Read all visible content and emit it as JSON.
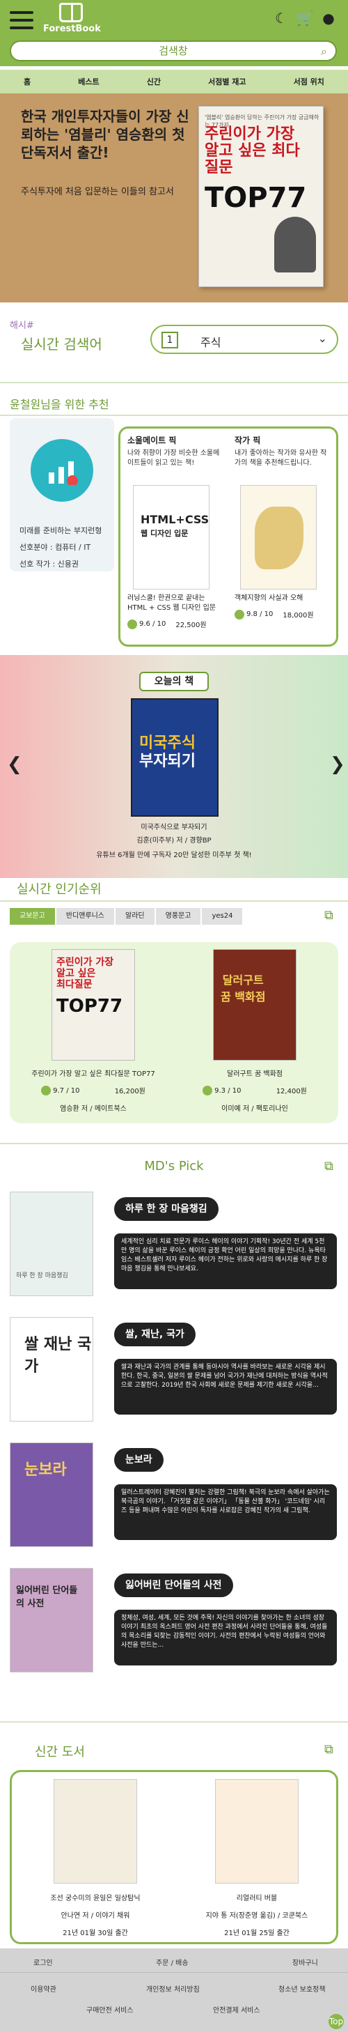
{
  "app": {
    "logo_text": "ForestBook"
  },
  "search": {
    "placeholder": "검색창"
  },
  "nav": [
    "홈",
    "베스트",
    "신간",
    "서점별 재고",
    "서점 위치"
  ],
  "banner": {
    "title": "한국 개인투자자들이 가장 신뢰하는 '염블리' 염승환의 첫 단독저서 출간!",
    "subtitle": "주식투자에 처음 입문하는 이들의 참고서",
    "book_top": "'염블리' 염승환이 답하는 주린이가 가장 궁금해하는 77가지",
    "book_title": "주린이가 가장 알고 싶은 최다질문",
    "book_big": "TOP77"
  },
  "realtime": {
    "hash": "해시#",
    "title": "실시간 검색어",
    "rank": "1",
    "keyword": "주식"
  },
  "recommend": {
    "title": "윤철원님을 위한 추천",
    "profile_label": "미래를 준비하는 부지런형",
    "field": "선호분야 : 컴퓨터 / IT",
    "author": "선호 작가 : 신용권",
    "soulmate": {
      "header": "소울메이트 픽",
      "desc": "나와 취향이 가장 비슷한 소울메이트들이 읽고 있는 책!",
      "book_title": "러닝스쿨! 한권으로 끝내는 HTML + CSS 웹 디자인 입문",
      "rating": "9.6 / 10",
      "price": "22,500원"
    },
    "writer": {
      "header": "작가 픽",
      "desc": "내가 좋아하는 작가와 유사한 작가의 책을 추천해드립니다.",
      "book_title": "객체지향의 사실과 오해",
      "rating": "9.8 / 10",
      "price": "18,000원"
    }
  },
  "today": {
    "title": "오늘의 책",
    "book_title": "미국주식으로 부자되기",
    "author": "김훈(미주부) 저 / 경향BP",
    "desc": "유튜브 6개월 만에 구독자 20만 달성한 미주부 첫 책!"
  },
  "ranking": {
    "title": "실시간 인기순위",
    "tabs": [
      "교보문고",
      "반디앤루니스",
      "알라딘",
      "영풍문고",
      "yes24"
    ],
    "items": [
      {
        "title": "주린이가 가장 알고 싶은 최다질문 TOP77",
        "rating": "9.7 / 10",
        "price": "16,200원",
        "author": "염승환 저 / 메이트북스"
      },
      {
        "title": "달러구트 꿈 백화점",
        "rating": "9.3 / 10",
        "price": "12,400원",
        "author": "이미예 저 / 팩토리나인"
      }
    ]
  },
  "md": {
    "title": "MD's Pick",
    "items": [
      {
        "head": "하루 한 장 마음챙김",
        "desc": "세계적인 심리 치료 전문가 루이스 헤이의 이야기 기획작! 30년간 전 세계 5천만 명의 삶을 바꾼 루이스 헤이의 긍정 확언 어린 일상의 희망을 만나다. 뉴욕타임스 베스트셀러 저자 루이스 헤이가 전하는 위로와 사랑의 메시지를 하루 한 장 마음 챙김을 통해 만나보세요.",
        "img_title": "하루 한 장 마음챙김"
      },
      {
        "head": "쌀, 재난, 국가",
        "desc": "쌀과 재난과 국가의 관계를 통해 동아시아 역사를 바라보는 새로운 시각을 제시한다. 한국, 중국, 일본의 쌀 문제를 넘어 국가가 재난에 대처하는 방식을 역사적으로 고찰한다. 2019년 한국 사회에 새로운 문제를 제기한 새로운 시각을...",
        "img_title": "쌀 재난 국가"
      },
      {
        "head": "눈보라",
        "desc": "일러스트레이터 강혜진이 펼치는 강렬한 그림책! 북극의 눈보라 속에서 살아가는 북극곰의 이야기. 「거짓말 같은 이야기」 「동물 산불 화가」 '코드네임' 시리즈 등을 펴내며 수많은 어린이 독자를 사로잡은 강혜진 작가의 새 그림책.",
        "img_title": "눈보라"
      },
      {
        "head": "잃어버린 단어들의 사전",
        "desc": "정체성, 여성, 세계, 모든 것에 주목! 자신의 이야기를 찾아가는 한 소녀의 성장 이야기 최초의 옥스퍼드 영어 사전 편찬 과정에서 사라진 단어들을 통해, 여성들의 목소리를 되찾는 감동적인 이야기. 사전의 편찬에서 누락된 여성들의 언어와 사전을 만드는...",
        "img_title": "잃어버린 단어들의 사전"
      }
    ]
  },
  "new_books": {
    "title": "신간 도서",
    "items": [
      {
        "title": "조선 궁수미의 윤일은 일상탐닉",
        "author": "안나연 저 / 이야기 채워",
        "date": "21년 01월 30일 출간"
      },
      {
        "title": "리얼러티 버블",
        "author": "지야 통 저(장준영 옮김) / 코쿤북스",
        "date": "21년 01월 25일 출간"
      }
    ]
  },
  "footer": {
    "row1": [
      "로그인",
      "주문 / 배송",
      "장바구니"
    ],
    "row2": [
      "이용약관",
      "개인정보 처리방침",
      "청소년 보호정책"
    ],
    "row3": [
      "구매안전 서비스",
      "안전결제 서비스"
    ],
    "top": "Top"
  }
}
